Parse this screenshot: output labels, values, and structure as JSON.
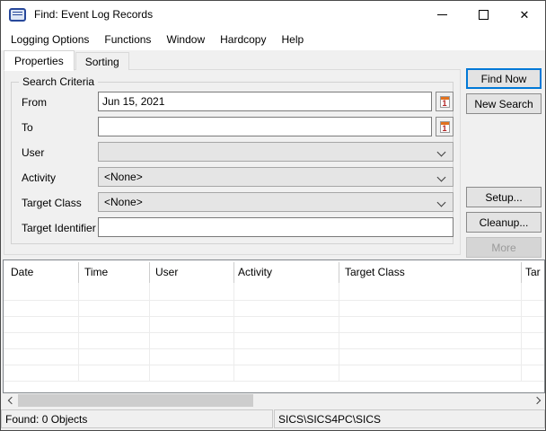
{
  "window": {
    "title": "Find: Event Log Records"
  },
  "menu": {
    "items": [
      "Logging Options",
      "Functions",
      "Window",
      "Hardcopy",
      "Help"
    ]
  },
  "tabs": {
    "properties": "Properties",
    "sorting": "Sorting",
    "active": "Properties"
  },
  "search_criteria": {
    "group_label": "Search Criteria",
    "from": {
      "label": "From",
      "value": "Jun 15, 2021"
    },
    "to": {
      "label": "To",
      "value": ""
    },
    "user": {
      "label": "User",
      "value": ""
    },
    "activity": {
      "label": "Activity",
      "value": "<None>"
    },
    "target_class": {
      "label": "Target Class",
      "value": "<None>"
    },
    "target_identifier": {
      "label": "Target Identifier",
      "value": ""
    }
  },
  "actions": {
    "find_now": "Find Now",
    "new_search": "New Search",
    "setup": "Setup...",
    "cleanup": "Cleanup...",
    "more": "More",
    "more_enabled": false
  },
  "results_table": {
    "columns": [
      "Date",
      "Time",
      "User",
      "Activity",
      "Target Class",
      "Tar"
    ],
    "rows": []
  },
  "status_bar": {
    "found": "Found: 0 Objects",
    "connection": "SICS\\SICS4PC\\SICS"
  },
  "colors": {
    "focus_accent": "#0078d7",
    "window_bg": "#f0f0f0",
    "titlebar_bg": "#ffffff",
    "combo_bg": "#e5e5e5",
    "calendar_header": "#e2711d"
  }
}
